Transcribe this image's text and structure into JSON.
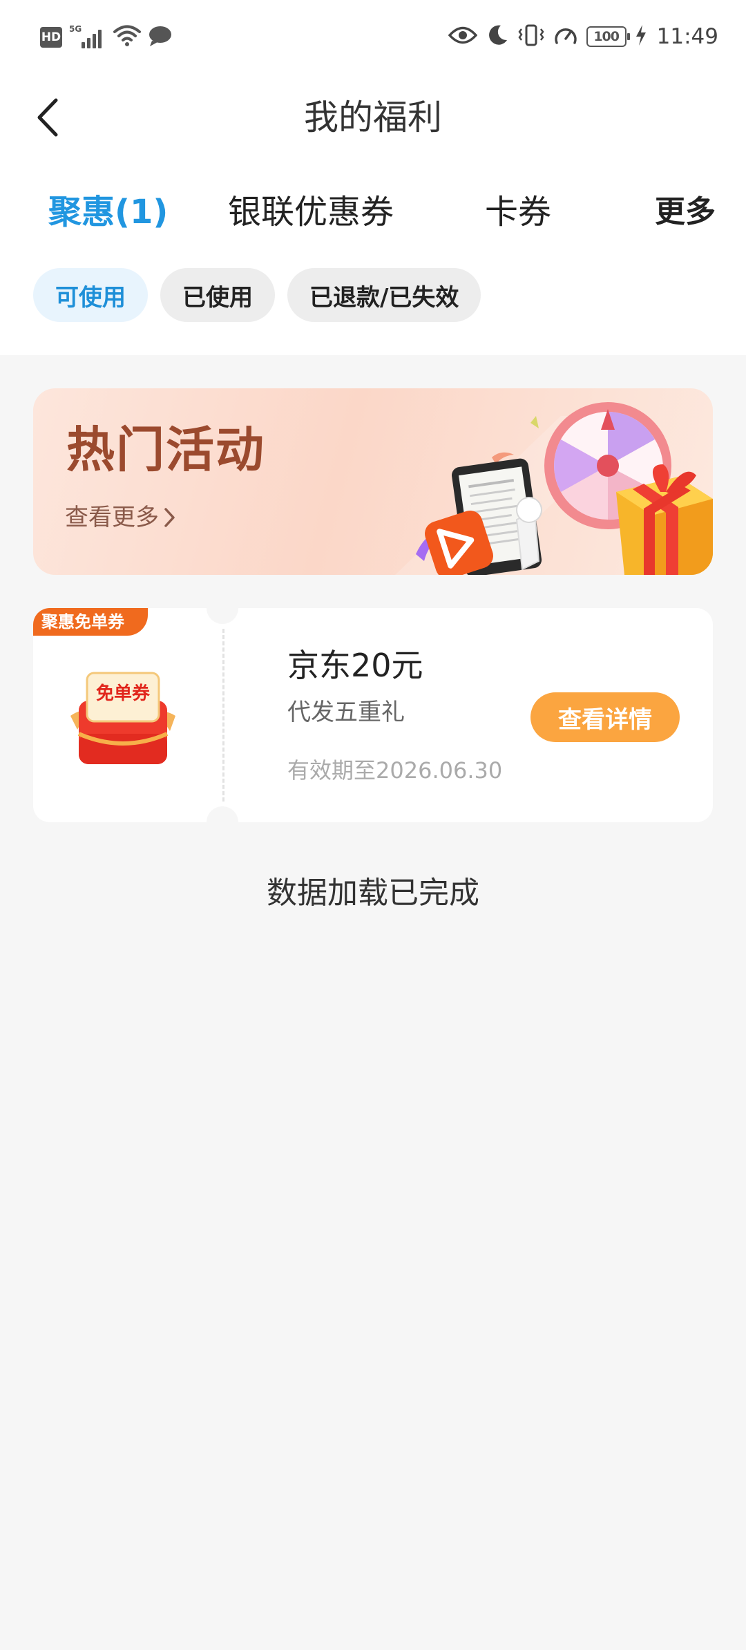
{
  "status_bar": {
    "network_badge": "HD",
    "network_type": "5G",
    "battery": "100",
    "time": "11:49"
  },
  "header": {
    "title": "我的福利"
  },
  "tabs": [
    {
      "label": "聚惠(1)",
      "active": true
    },
    {
      "label": "银联优惠券",
      "active": false
    },
    {
      "label": "卡券",
      "active": false
    },
    {
      "label": "更多",
      "active": false
    }
  ],
  "filters": [
    {
      "label": "可使用",
      "active": true
    },
    {
      "label": "已使用",
      "active": false
    },
    {
      "label": "已退款/已失效",
      "active": false
    }
  ],
  "banner": {
    "title": "热门活动",
    "link_label": "查看更多"
  },
  "coupon": {
    "badge": "聚惠免单券",
    "image_label": "免单券",
    "title": "京东20元",
    "subtitle": "代发五重礼",
    "validity": "有效期至2026.06.30",
    "button_label": "查看详情"
  },
  "footer": {
    "status_text": "数据加载已完成"
  },
  "colors": {
    "accent": "#2196e0",
    "button": "#fba540",
    "badge": "#f06a1e",
    "banner_title": "#9b4a2e"
  }
}
